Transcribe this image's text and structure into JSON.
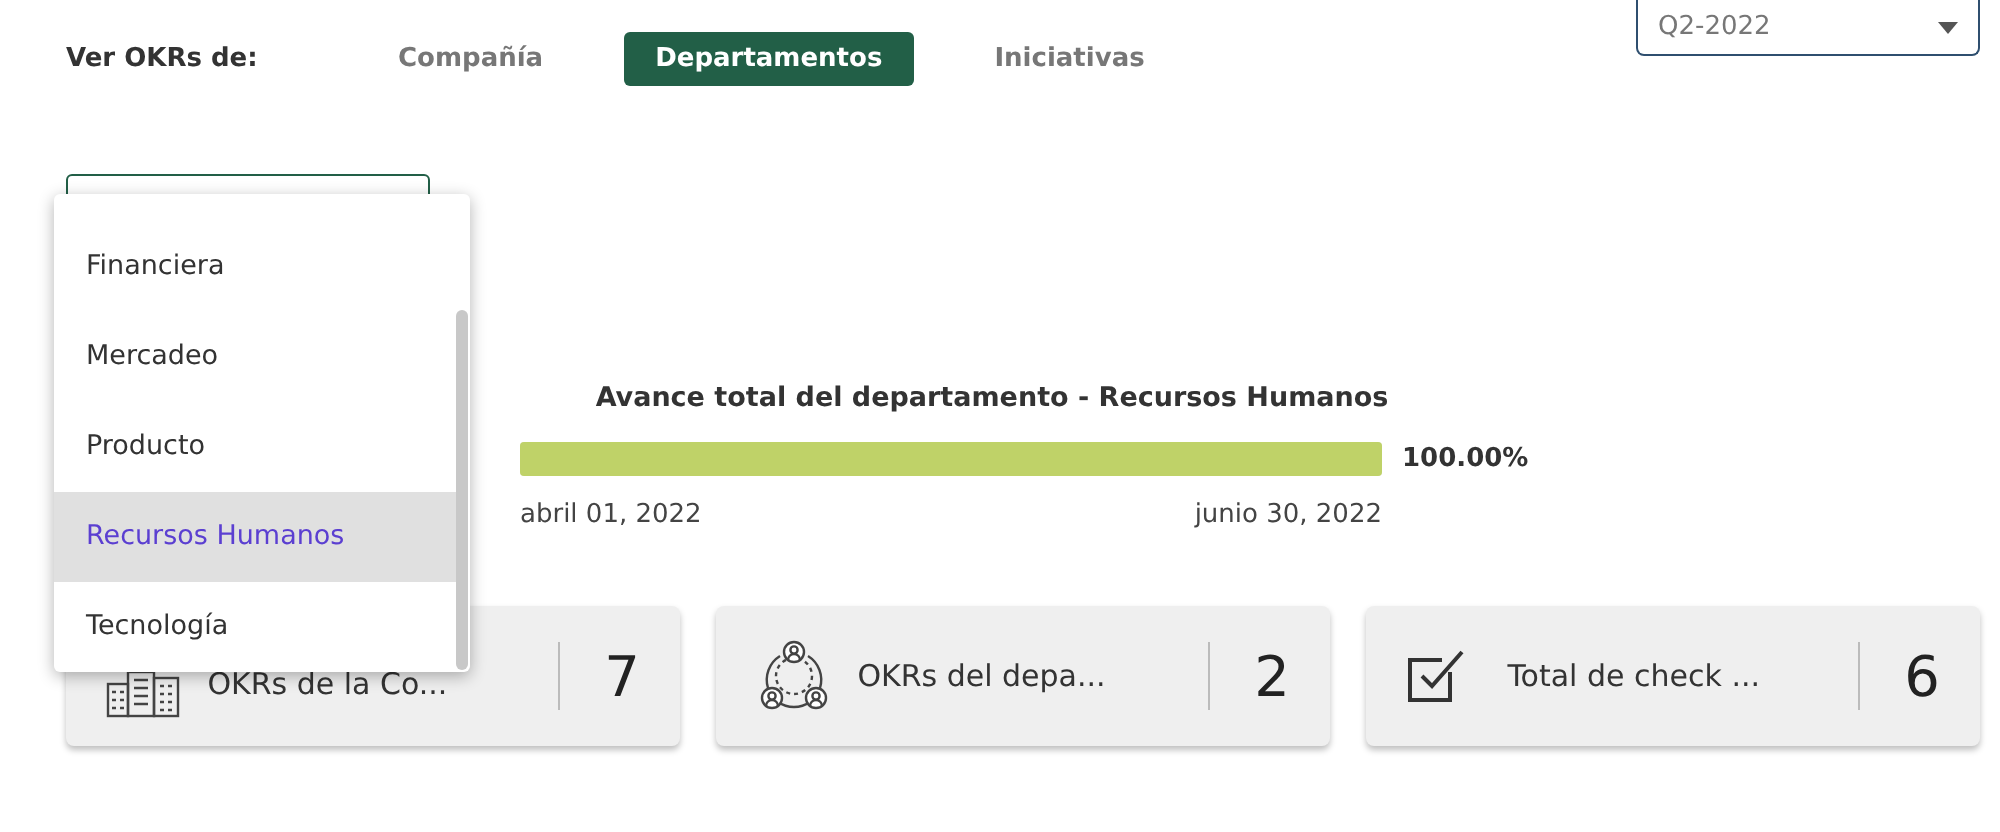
{
  "view_selector": {
    "label": "Ver OKRs de:",
    "tabs": [
      {
        "label": "Compañía",
        "selected": false
      },
      {
        "label": "Departamentos",
        "selected": true
      },
      {
        "label": "Iniciativas",
        "selected": false
      }
    ]
  },
  "period_select": {
    "value": "Q2-2022"
  },
  "department_menu": {
    "items": [
      {
        "label": "Financiera",
        "selected": false
      },
      {
        "label": "Mercadeo",
        "selected": false
      },
      {
        "label": "Producto",
        "selected": false
      },
      {
        "label": "Recursos Humanos",
        "selected": true
      },
      {
        "label": "Tecnología",
        "selected": false
      }
    ]
  },
  "progress": {
    "title": "Avance total del departamento - Recursos Humanos",
    "level": 1,
    "percent": "100.00%",
    "start_date": "abril 01, 2022",
    "end_date": "junio 30, 2022"
  },
  "cards": [
    {
      "kind": "building",
      "label": "OKRs de la Co...",
      "value": "7"
    },
    {
      "kind": "team",
      "label": "OKRs del depa...",
      "value": "2"
    },
    {
      "kind": "checkbox",
      "label": "Total de check ...",
      "value": "6"
    }
  ]
}
